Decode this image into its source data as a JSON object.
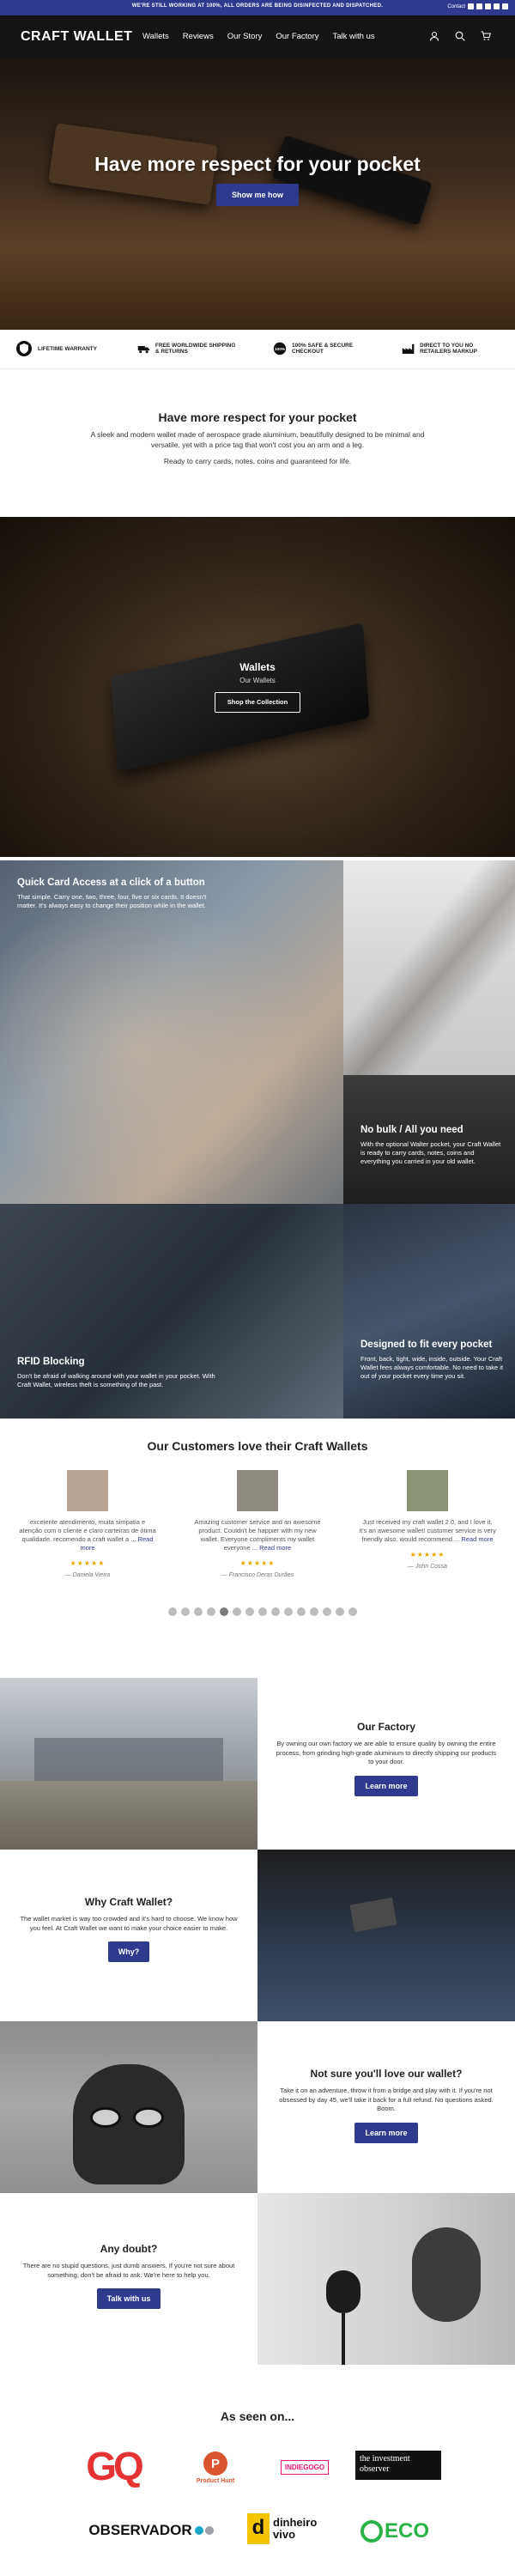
{
  "announcement": {
    "text": "WE'RE STILL WORKING AT 100%, ALL ORDERS ARE BEING DISINFECTED AND DISPATCHED.",
    "contact": "Contact"
  },
  "header": {
    "logo": "CRAFT WALLET",
    "nav": [
      "Wallets",
      "Reviews",
      "Our Story",
      "Our Factory",
      "Talk with us"
    ]
  },
  "hero": {
    "title": "Have more respect for your pocket",
    "button": "Show me how"
  },
  "features": [
    {
      "icon": "shield-icon",
      "label": "LIFETIME WARRANTY"
    },
    {
      "icon": "truck-icon",
      "label": "FREE WORLDWIDE SHIPPING & RETURNS"
    },
    {
      "icon": "badge-100-icon",
      "label": "100% SAFE & SECURE CHECKOUT"
    },
    {
      "icon": "factory-icon",
      "label": "DIRECT TO YOU NO RETAILERS MARKUP"
    }
  ],
  "intro": {
    "title": "Have more respect for your pocket",
    "text": "A sleek and modern wallet made of aerospace grade aluminium, beautifully designed to be minimal and versatile, yet with a price tag that won't cost you an arm and a leg.",
    "text2": "Ready to carry cards, notes, coins and guaranteed for life."
  },
  "collection": {
    "title": "Wallets",
    "subtitle": "Our Wallets",
    "button": "Shop the Collection"
  },
  "tiles": {
    "quick": {
      "title": "Quick Card Access at a click of a button",
      "text": "That simple. Carry one, two, three, four, five or six cards. It doesn't matter. It's always easy to change their position while in the wallet."
    },
    "bulk": {
      "title": "No bulk / All you need",
      "text": "With the optional Walter pocket, your Craft Wallet is ready to carry cards, notes, coins and everything you carried in your old wallet."
    },
    "rfid": {
      "title": "RFID Blocking",
      "text": "Don't be afraid of walking around with your wallet in your pocket. With Craft Wallet, wireless theft is something of the past."
    },
    "design": {
      "title": "Designed to fit every pocket",
      "text": "Front, back, tight, wide, inside, outside. Your Craft Wallet fees always comfortable. No need to take it out of your pocket every time you sit."
    }
  },
  "reviews": {
    "title": "Our Customers love their Craft Wallets",
    "items": [
      {
        "text": "excelente atendimento, muita simpatia e atenção com o cliente e claro carteiras de ótima qualidade. recomendo a craft wallet a",
        "more": "... Read more",
        "stars": "★★★★★",
        "author": "— Daniela Vieira"
      },
      {
        "text": "Amazing customer service and an awesome product. Couldn't be happier with my new wallet. Everyone compliments my wallet everyone",
        "more": "... Read more",
        "stars": "★★★★★",
        "author": "— Francisco Deras Durães"
      },
      {
        "text": "Just received my craft wallet 2.0, and I love it. It's an awesome wallet! customer service is very friendly also. would recommend",
        "more": "... Read more",
        "stars": "★★★★★",
        "author": "— John Cossa"
      }
    ],
    "dots": 15,
    "active_dot": 4
  },
  "factory": {
    "title": "Our Factory",
    "text": "By owning our own factory we are able to ensure quality by owning the entire process, from grinding high-grade aluminium to directly shipping our products to your door.",
    "button": "Learn more"
  },
  "why": {
    "title": "Why Craft Wallet?",
    "text": "The wallet market is way too crowded and it's hard to choose. We know how you feel. At Craft Wallet we want to make your choice easier to make.",
    "button": "Why?"
  },
  "notsure": {
    "title": "Not sure you'll love our wallet?",
    "text": "Take it on an adventure, throw it from a bridge and play with it. If you're not obsessed by day 45, we'll take it back for a full refund. No questions asked. Boom.",
    "button": "Learn more"
  },
  "doubt": {
    "title": "Any doubt?",
    "text": "There are no stupid questions, just dumb answers. If you're not sure about something, don't be afraid to ask. We're here to help you.",
    "button": "Talk with us"
  },
  "seen": {
    "title": "As seen on...",
    "logos": [
      "GQ",
      "Product Hunt",
      "INDIEGOGO",
      "the investment observer",
      "OBSERVADOR",
      "dinheiro vivo",
      "ECO"
    ]
  },
  "colors": {
    "accent": "#2f3a8f",
    "header": "#141414"
  }
}
